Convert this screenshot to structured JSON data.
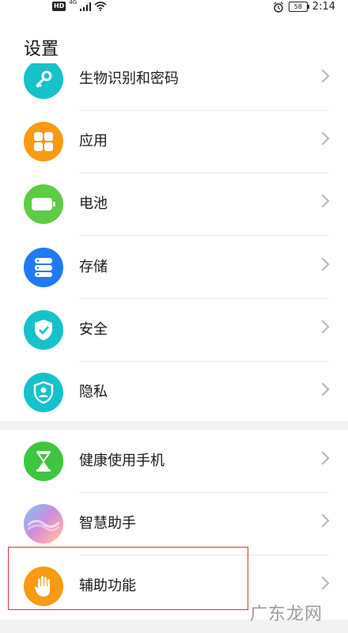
{
  "status_bar": {
    "hd": "HD",
    "network": "4G",
    "battery": "58",
    "time": "2:14"
  },
  "page": {
    "title": "设置"
  },
  "groups": [
    {
      "items": [
        {
          "label": "生物识别和密码",
          "icon": "key-icon",
          "color": "#16c2c9"
        },
        {
          "label": "应用",
          "icon": "apps-grid-icon",
          "color": "#f79b13"
        },
        {
          "label": "电池",
          "icon": "battery-icon",
          "color": "#5ccc45"
        },
        {
          "label": "存储",
          "icon": "storage-icon",
          "color": "#1e7bf5"
        },
        {
          "label": "安全",
          "icon": "shield-check-icon",
          "color": "#16c2c9"
        },
        {
          "label": "隐私",
          "icon": "privacy-shield-icon",
          "color": "#16c2c9"
        }
      ]
    },
    {
      "items": [
        {
          "label": "健康使用手机",
          "icon": "hourglass-icon",
          "color": "#3ec63e"
        },
        {
          "label": "智慧助手",
          "icon": "smart-assistant-icon",
          "color": "#a57ae6"
        },
        {
          "label": "辅助功能",
          "icon": "hand-icon",
          "color": "#f79b13"
        }
      ]
    }
  ],
  "watermark": "广东龙网"
}
